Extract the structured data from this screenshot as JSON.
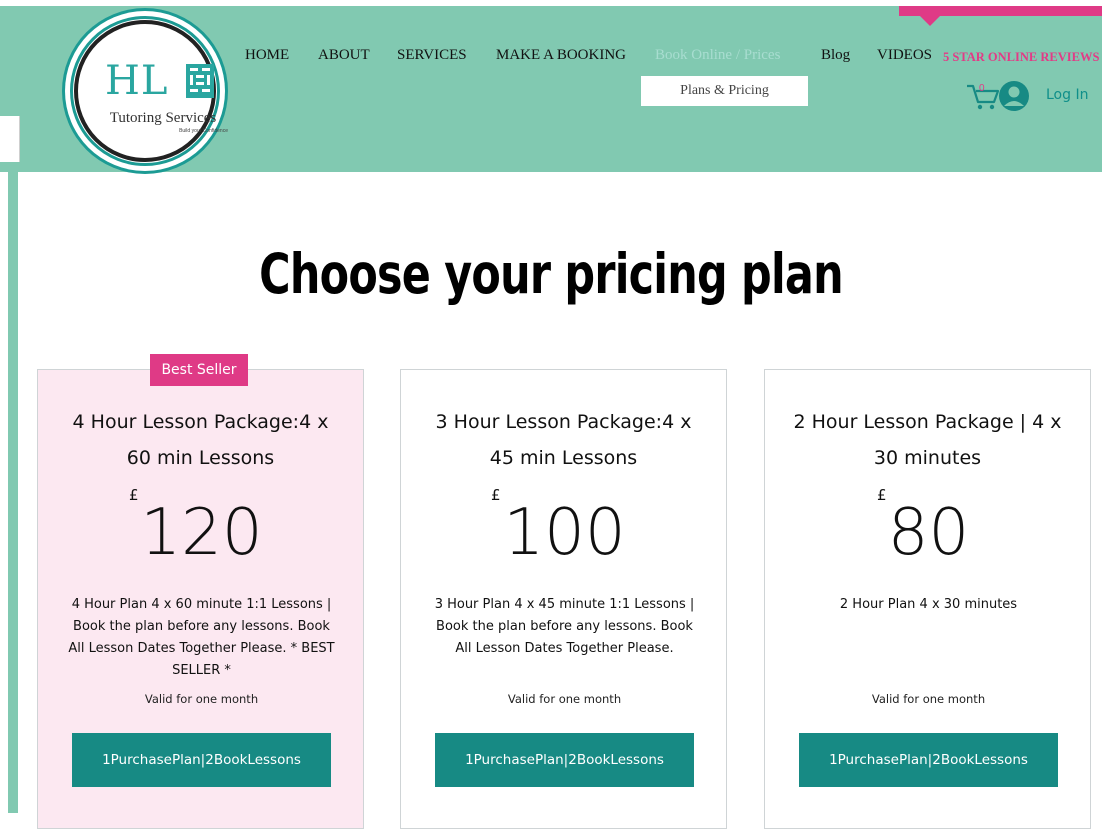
{
  "logo": {
    "initials": "HL",
    "name": "Tutoring Services",
    "tagline": "Build your Confidence"
  },
  "nav": {
    "items": [
      "HOME",
      "ABOUT",
      "SERVICES",
      "MAKE A BOOKING",
      "Book Online / Prices",
      "Blog",
      "VIDEOS"
    ],
    "reviews": "5 STAR ONLINE REVIEWS",
    "dropdown_item": "Plans & Pricing"
  },
  "cart": {
    "count": "0"
  },
  "login": "Log In",
  "page": {
    "title": "Choose your pricing plan"
  },
  "plans": [
    {
      "badge": "Best Seller",
      "title": "4 Hour Lesson Package:4 x 60 min Lessons",
      "currency": "£",
      "price": "120",
      "description": "4 Hour Plan 4 x 60 minute 1:1 Lessons | Book the plan before any lessons. Book All Lesson Dates Together Please. * BEST SELLER *",
      "validity": "Valid for one month",
      "cta": "1PurchasePlan|2BookLessons"
    },
    {
      "title": "3 Hour Lesson Package:4 x 45 min Lessons",
      "currency": "£",
      "price": "100",
      "description": "3 Hour Plan 4 x 45 minute 1:1 Lessons | Book the plan before any lessons. Book All Lesson Dates Together Please.",
      "validity": "Valid for one month",
      "cta": "1PurchasePlan|2BookLessons"
    },
    {
      "title": "2 Hour Lesson Package | 4 x 30 minutes",
      "currency": "£",
      "price": "80",
      "description": "2 Hour Plan 4 x 30 minutes",
      "validity": "Valid for one month",
      "cta": "1PurchasePlan|2BookLessons"
    }
  ],
  "colors": {
    "header_bg": "#81c9b1",
    "accent_pink": "#df3a86",
    "button_teal": "#178a84",
    "featured_card_bg": "#fce8f1"
  }
}
